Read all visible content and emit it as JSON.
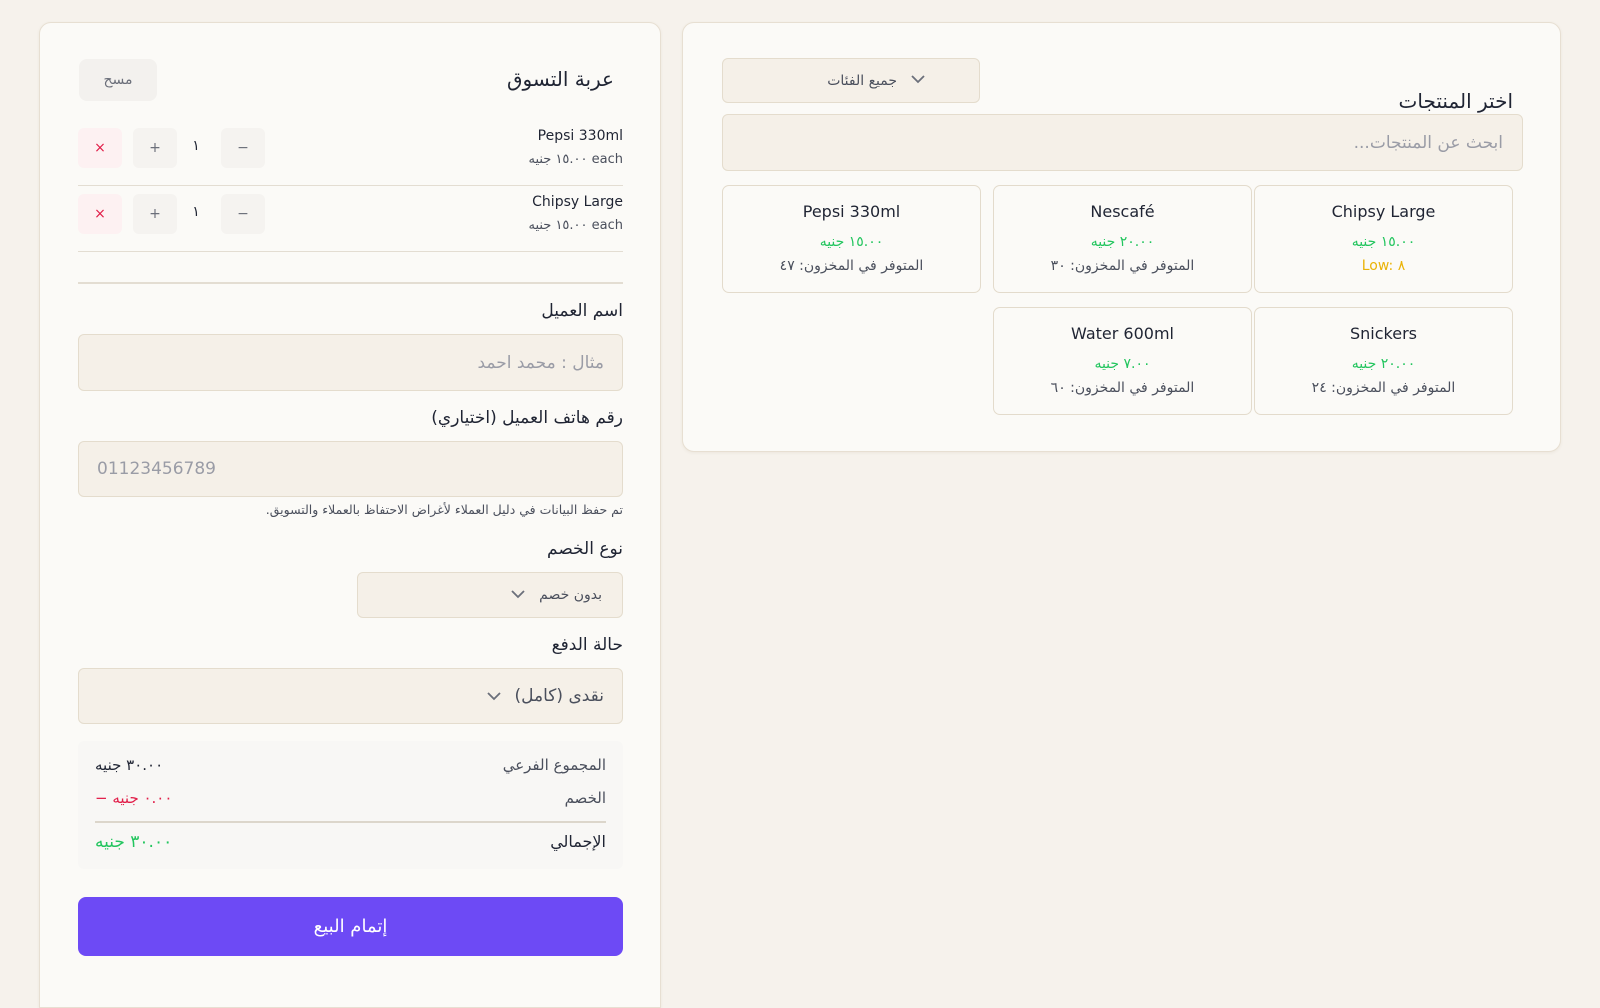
{
  "products_panel": {
    "title": "اختر المنتجات",
    "category_select": {
      "value": "جميع الفئات"
    },
    "search": {
      "placeholder": "ابحث عن المنتجات..."
    },
    "products": [
      {
        "name": "Chipsy Large",
        "price": "١٥.٠٠ جنيه",
        "stock": "Low: ٨",
        "low_stock": true
      },
      {
        "name": "Nescafé",
        "price": "٢٠.٠٠ جنيه",
        "stock": "المتوفر في المخزون: ٣٠",
        "low_stock": false
      },
      {
        "name": "Pepsi 330ml",
        "price": "١٥.٠٠ جنيه",
        "stock": "المتوفر في المخزون: ٤٧",
        "low_stock": false
      },
      {
        "name": "Snickers",
        "price": "٢٠.٠٠ جنيه",
        "stock": "المتوفر في المخزون: ٢٤",
        "low_stock": false
      },
      {
        "name": "Water 600ml",
        "price": "٧.٠٠ جنيه",
        "stock": "المتوفر في المخزون: ٦٠",
        "low_stock": false
      }
    ]
  },
  "cart": {
    "title": "عربة التسوق",
    "clear_label": "مسح",
    "items": [
      {
        "name": "Pepsi 330ml",
        "unit_price": "١٥.٠٠ جنيه each",
        "qty": "١",
        "minus": "−",
        "plus": "+",
        "remove": "×"
      },
      {
        "name": "Chipsy Large",
        "unit_price": "١٥.٠٠ جنيه each",
        "qty": "١",
        "minus": "−",
        "plus": "+",
        "remove": "×"
      }
    ],
    "customer_name": {
      "label": "اسم العميل",
      "placeholder": "مثال : محمد احمد",
      "value": ""
    },
    "customer_phone": {
      "label": "رقم هاتف العميل (اختياري)",
      "placeholder": "01123456789",
      "value": ""
    },
    "privacy_hint": "تم حفظ البيانات في دليل العملاء لأغراض الاحتفاظ بالعملاء والتسويق.",
    "discount": {
      "label": "نوع الخصم",
      "value": "بدون خصم"
    },
    "payment": {
      "label": "حالة الدفع",
      "value": "نقدى (كامل)"
    },
    "summary": {
      "subtotal_label": "المجموع الفرعي",
      "subtotal_value": "٣٠.٠٠ جنيه",
      "discount_label": "الخصم",
      "discount_value": "− ٠.٠٠ جنيه",
      "total_label": "الإجمالي",
      "total_value": "٣٠.٠٠ جنيه"
    },
    "complete_label": "إتمام البيع"
  },
  "colors": {
    "accent": "#6d4af5",
    "success": "#22c55e",
    "danger": "#e11d48",
    "warning": "#eab308",
    "background": "#f6f2ec"
  },
  "icons": {
    "dropdown": "chevron-down-icon",
    "remove": "close-icon",
    "increment": "plus-icon",
    "decrement": "minus-icon"
  }
}
